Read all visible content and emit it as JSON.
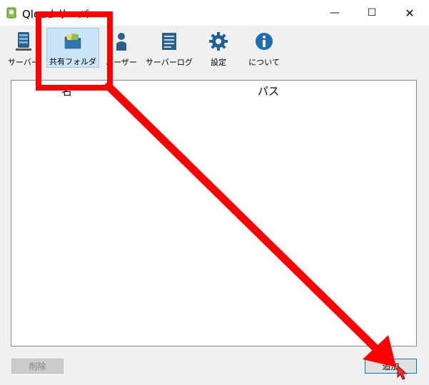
{
  "window": {
    "title": "Qloud サーバ",
    "controls": {
      "minimize": "—",
      "maximize": "☐",
      "close": "✕"
    }
  },
  "toolbar": {
    "items": [
      {
        "label": "サーバー",
        "icon": "server-icon"
      },
      {
        "label": "共有フォルダ",
        "icon": "shared-folder-icon",
        "selected": true
      },
      {
        "label": "ユーザー",
        "icon": "user-icon"
      },
      {
        "label": "サーバーログ",
        "icon": "log-icon"
      },
      {
        "label": "設定",
        "icon": "gear-icon"
      },
      {
        "label": "について",
        "icon": "info-icon"
      }
    ]
  },
  "table": {
    "columns": [
      "名",
      "パス"
    ],
    "rows": []
  },
  "buttons": {
    "delete": "削除",
    "add": "追加"
  },
  "annotation": {
    "color": "#ff0000",
    "type": "highlight-box-and-arrow"
  }
}
